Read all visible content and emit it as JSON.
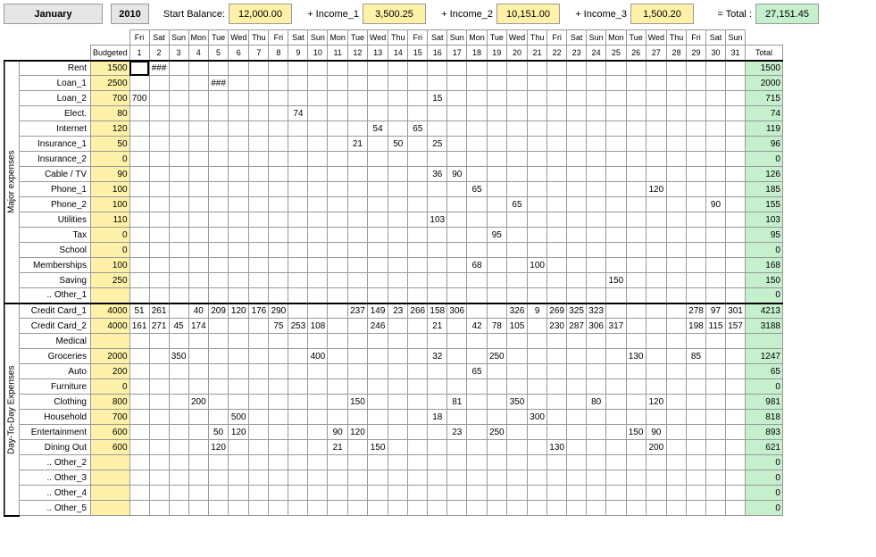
{
  "top": {
    "month": "January",
    "year": "2010",
    "start_balance_label": "Start Balance:",
    "start_balance": "12,000.00",
    "income1_label": "+ Income_1",
    "income1": "3,500.25",
    "income2_label": "+ Income_2",
    "income2": "10,151.00",
    "income3_label": "+ Income_3",
    "income3": "1,500.20",
    "total_label": "= Total :",
    "total": "27,151.45"
  },
  "headers": {
    "budgeted": "Budgeted",
    "total": "Total",
    "dow": [
      "Fri",
      "Sat",
      "Sun",
      "Mon",
      "Tue",
      "Wed",
      "Thu",
      "Fri",
      "Sat",
      "Sun",
      "Mon",
      "Tue",
      "Wed",
      "Thu",
      "Fri",
      "Sat",
      "Sun",
      "Mon",
      "Tue",
      "Wed",
      "Thu",
      "Fri",
      "Sat",
      "Sun",
      "Mon",
      "Tue",
      "Wed",
      "Thu",
      "Fri",
      "Sat",
      "Sun"
    ],
    "days": [
      "1",
      "2",
      "3",
      "4",
      "5",
      "6",
      "7",
      "8",
      "9",
      "10",
      "11",
      "12",
      "13",
      "14",
      "15",
      "16",
      "17",
      "18",
      "19",
      "20",
      "21",
      "22",
      "23",
      "24",
      "25",
      "26",
      "27",
      "28",
      "29",
      "30",
      "31"
    ]
  },
  "sections": {
    "major": "Major expenses",
    "day": "Day-To-Day Expenses"
  },
  "major_rows": [
    {
      "label": "Rent",
      "budget": "1500",
      "cells": {
        "2": "###"
      },
      "total": "1500"
    },
    {
      "label": "Loan_1",
      "budget": "2500",
      "cells": {
        "5": "###"
      },
      "total": "2000"
    },
    {
      "label": "Loan_2",
      "budget": "700",
      "cells": {
        "1": "700",
        "16": "15"
      },
      "total": "715"
    },
    {
      "label": "Elect.",
      "budget": "80",
      "cells": {
        "9": "74"
      },
      "total": "74"
    },
    {
      "label": "Internet",
      "budget": "120",
      "cells": {
        "13": "54",
        "15": "65"
      },
      "total": "119"
    },
    {
      "label": "Insurance_1",
      "budget": "50",
      "cells": {
        "12": "21",
        "14": "50",
        "16": "25"
      },
      "total": "96"
    },
    {
      "label": "Insurance_2",
      "budget": "0",
      "cells": {},
      "total": "0"
    },
    {
      "label": "Cable / TV",
      "budget": "90",
      "cells": {
        "16": "36",
        "17": "90"
      },
      "total": "126"
    },
    {
      "label": "Phone_1",
      "budget": "100",
      "cells": {
        "18": "65",
        "27": "120"
      },
      "total": "185"
    },
    {
      "label": "Phone_2",
      "budget": "100",
      "cells": {
        "20": "65",
        "30": "90"
      },
      "total": "155"
    },
    {
      "label": "Utilities",
      "budget": "110",
      "cells": {
        "16": "103"
      },
      "total": "103"
    },
    {
      "label": "Tax",
      "budget": "0",
      "cells": {
        "19": "95"
      },
      "total": "95"
    },
    {
      "label": "School",
      "budget": "0",
      "cells": {},
      "total": "0"
    },
    {
      "label": "Memberships",
      "budget": "100",
      "cells": {
        "18": "68",
        "21": "100"
      },
      "total": "168"
    },
    {
      "label": "Saving",
      "budget": "250",
      "cells": {
        "25": "150"
      },
      "total": "150"
    },
    {
      "label": ".. Other_1",
      "budget": "",
      "cells": {},
      "total": "0"
    }
  ],
  "day_rows": [
    {
      "label": "Credit Card_1",
      "budget": "4000",
      "cells": {
        "1": "51",
        "2": "261",
        "4": "40",
        "5": "209",
        "6": "120",
        "7": "176",
        "8": "290",
        "12": "237",
        "13": "149",
        "14": "23",
        "15": "266",
        "16": "158",
        "17": "306",
        "20": "326",
        "21": "9",
        "22": "269",
        "23": "325",
        "24": "323",
        "29": "278",
        "30": "97",
        "31": "301"
      },
      "total": "4213"
    },
    {
      "label": "Credit Card_2",
      "budget": "4000",
      "cells": {
        "1": "161",
        "2": "271",
        "3": "45",
        "4": "174",
        "8": "75",
        "9": "253",
        "10": "108",
        "13": "246",
        "16": "21",
        "18": "42",
        "19": "78",
        "20": "105",
        "22": "230",
        "23": "287",
        "24": "306",
        "25": "317",
        "29": "198",
        "30": "115",
        "31": "157"
      },
      "total": "3188"
    },
    {
      "label": "Medical",
      "budget": "",
      "cells": {},
      "total": ""
    },
    {
      "label": "Groceries",
      "budget": "2000",
      "cells": {
        "3": "350",
        "10": "400",
        "16": "32",
        "19": "250",
        "26": "130",
        "29": "85"
      },
      "total": "1247"
    },
    {
      "label": "Auto",
      "budget": "200",
      "cells": {
        "18": "65"
      },
      "total": "65"
    },
    {
      "label": "Furniture",
      "budget": "0",
      "cells": {},
      "total": "0"
    },
    {
      "label": "Clothing",
      "budget": "800",
      "cells": {
        "4": "200",
        "12": "150",
        "17": "81",
        "20": "350",
        "24": "80",
        "27": "120"
      },
      "total": "981"
    },
    {
      "label": "Household",
      "budget": "700",
      "cells": {
        "6": "500",
        "16": "18",
        "21": "300"
      },
      "total": "818"
    },
    {
      "label": "Entertainment",
      "budget": "600",
      "cells": {
        "5": "50",
        "6": "120",
        "11": "90",
        "12": "120",
        "17": "23",
        "19": "250",
        "26": "150",
        "27": "90"
      },
      "total": "893"
    },
    {
      "label": "Dining Out",
      "budget": "600",
      "cells": {
        "5": "120",
        "11": "21",
        "13": "150",
        "22": "130",
        "27": "200"
      },
      "total": "621"
    },
    {
      "label": ".. Other_2",
      "budget": "",
      "cells": {},
      "total": "0"
    },
    {
      "label": ".. Other_3",
      "budget": "",
      "cells": {},
      "total": "0"
    },
    {
      "label": ".. Other_4",
      "budget": "",
      "cells": {},
      "total": "0"
    },
    {
      "label": ".. Other_5",
      "budget": "",
      "cells": {},
      "total": "0"
    }
  ]
}
